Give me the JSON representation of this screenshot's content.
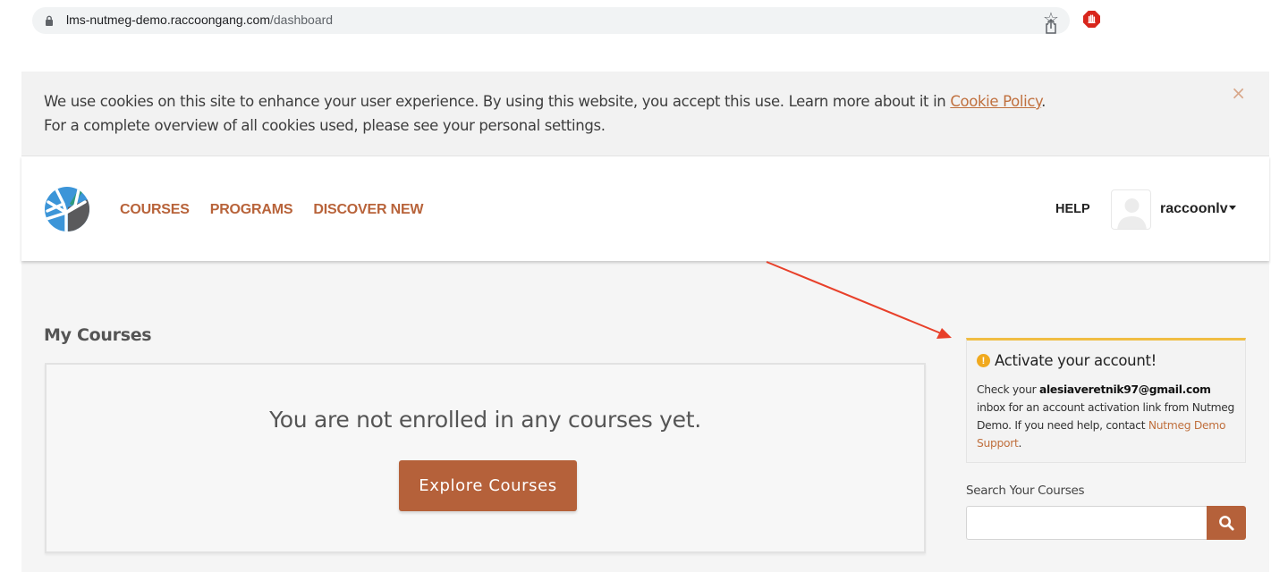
{
  "browser": {
    "url_host": "lms-nutmeg-demo.raccoongang.com",
    "url_path": "/dashboard",
    "icons": [
      "lock-icon",
      "share-icon",
      "bookmark-star-icon",
      "adblock-extension-icon"
    ]
  },
  "cookie_banner": {
    "line1_text": "We use cookies on this site to enhance your user experience. By using this website, you accept this use. Learn more about it in ",
    "policy_link": "Cookie Policy",
    "line1_end": ".",
    "line2_text": "For a complete overview of all cookies used, please see your personal settings.",
    "close_icon": "×"
  },
  "header": {
    "nav": [
      {
        "label": "COURSES"
      },
      {
        "label": "PROGRAMS"
      },
      {
        "label": "DISCOVER NEW"
      }
    ],
    "help_label": "HELP",
    "username": "raccoonlv"
  },
  "main": {
    "section_title": "My Courses",
    "empty_message": "You are not enrolled in any courses yet.",
    "explore_button": "Explore Courses"
  },
  "sidebar": {
    "activate": {
      "icon": "!",
      "title": "Activate your account!",
      "body_prefix": "Check your ",
      "email": "alesiaveretnik97@gmail.com",
      "body_middle": " inbox for an account activation link from Nutmeg Demo. If you need help, contact ",
      "support_link": "Nutmeg Demo Support",
      "body_suffix": "."
    },
    "search": {
      "label": "Search Your Courses",
      "value": "",
      "placeholder": ""
    }
  },
  "colors": {
    "brand_accent": "#b5613a",
    "link": "#c0703e",
    "warning": "#f0bd43",
    "annotation_arrow": "#e8402a"
  }
}
